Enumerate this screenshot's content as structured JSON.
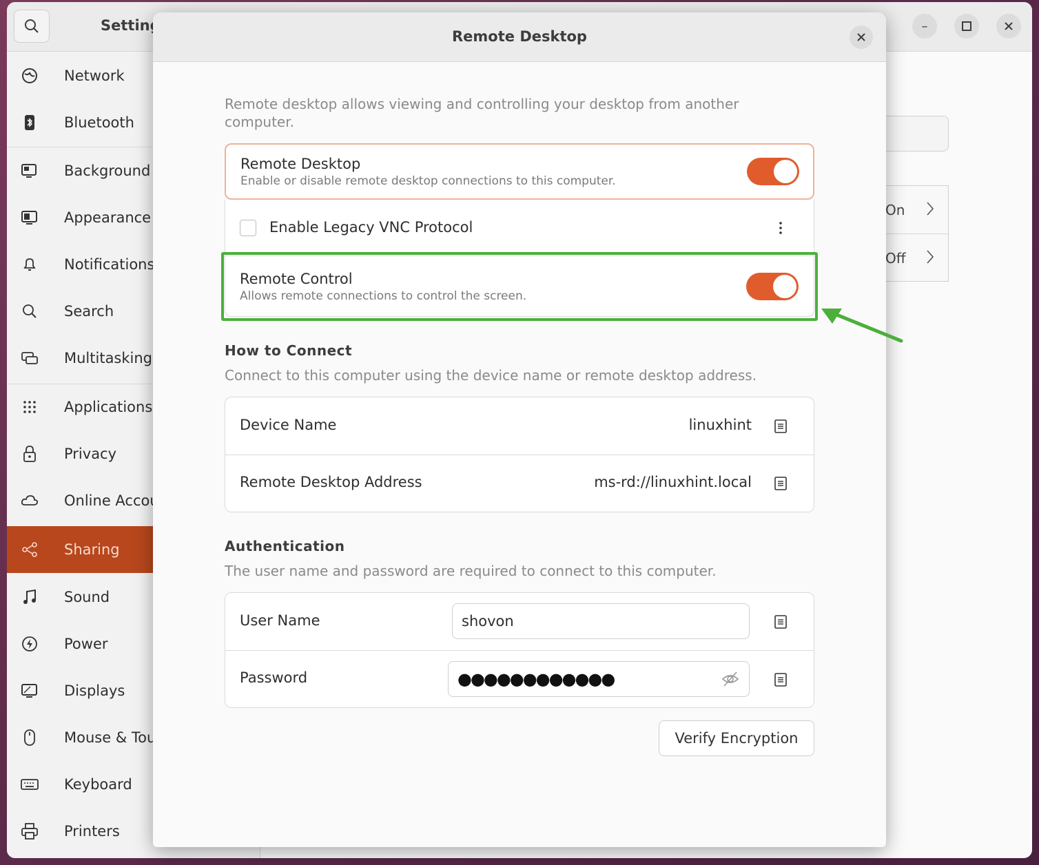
{
  "app": {
    "title": "Setting"
  },
  "sidebar": {
    "items": [
      {
        "label": "Network",
        "icon": "network-icon"
      },
      {
        "label": "Bluetooth",
        "icon": "bluetooth-icon"
      },
      {
        "label": "Background",
        "icon": "background-icon"
      },
      {
        "label": "Appearance",
        "icon": "appearance-icon"
      },
      {
        "label": "Notifications",
        "icon": "bell-icon"
      },
      {
        "label": "Search",
        "icon": "search-icon"
      },
      {
        "label": "Multitasking",
        "icon": "multitasking-icon"
      },
      {
        "label": "Applications",
        "icon": "grid-icon"
      },
      {
        "label": "Privacy",
        "icon": "lock-icon"
      },
      {
        "label": "Online Account",
        "icon": "cloud-icon"
      },
      {
        "label": "Sharing",
        "icon": "share-icon",
        "active": true
      },
      {
        "label": "Sound",
        "icon": "music-note-icon"
      },
      {
        "label": "Power",
        "icon": "power-icon"
      },
      {
        "label": "Displays",
        "icon": "display-icon"
      },
      {
        "label": "Mouse & Touch",
        "icon": "mouse-icon"
      },
      {
        "label": "Keyboard",
        "icon": "keyboard-icon"
      },
      {
        "label": "Printers",
        "icon": "printer-icon"
      }
    ]
  },
  "background_panel": {
    "rows": [
      "On",
      "Off"
    ]
  },
  "dialog": {
    "title": "Remote Desktop",
    "description": "Remote desktop allows viewing and controlling your desktop from another computer.",
    "remote_desktop": {
      "title": "Remote Desktop",
      "subtitle": "Enable or disable remote desktop connections to this computer.",
      "enabled": true
    },
    "legacy_vnc": {
      "label": "Enable Legacy VNC Protocol",
      "checked": false
    },
    "remote_control": {
      "title": "Remote Control",
      "subtitle": "Allows remote connections to control the screen.",
      "enabled": true
    },
    "how_to_connect": {
      "heading": "How to Connect",
      "description": "Connect to this computer using the device name or remote desktop address.",
      "device_name_label": "Device Name",
      "device_name_value": "linuxhint",
      "address_label": "Remote Desktop Address",
      "address_value": "ms-rd://linuxhint.local"
    },
    "authentication": {
      "heading": "Authentication",
      "description": "The user name and password are required to connect to this computer.",
      "user_name_label": "User Name",
      "user_name_value": "shovon",
      "password_label": "Password",
      "password_mask": "●●●●●●●●●●●●"
    },
    "verify_button": "Verify Encryption"
  },
  "colors": {
    "accent": "#e05c2d",
    "sidebar_active": "#b8471d",
    "highlight_green": "#4caf3c"
  }
}
